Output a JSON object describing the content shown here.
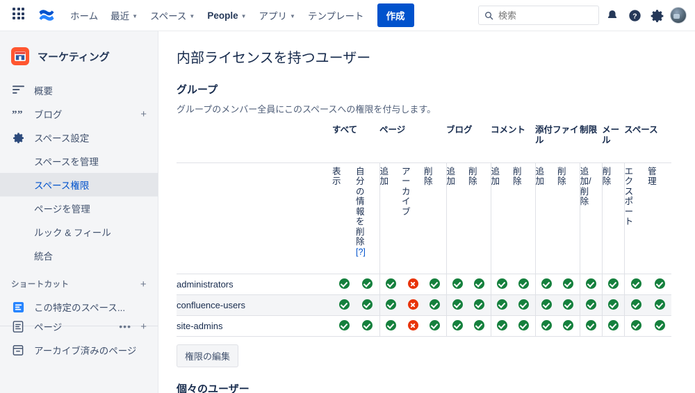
{
  "topnav": {
    "app_switcher": "app-switcher-icon",
    "logo": "confluence-logo",
    "items": [
      {
        "label": "ホーム",
        "caret": false,
        "bold": false
      },
      {
        "label": "最近",
        "caret": true,
        "bold": false
      },
      {
        "label": "スペース",
        "caret": true,
        "bold": false
      },
      {
        "label": "People",
        "caret": true,
        "bold": true
      },
      {
        "label": "アプリ",
        "caret": true,
        "bold": false
      },
      {
        "label": "テンプレート",
        "caret": false,
        "bold": false
      }
    ],
    "create_label": "作成",
    "search_placeholder": "検索",
    "icons": [
      "notification-bell-icon",
      "help-icon",
      "settings-gear-icon",
      "avatar"
    ],
    "accent": "#0052cc"
  },
  "sidebar": {
    "space_name": "マーケティング",
    "space_icon_color": "#ff5630",
    "nav": [
      {
        "label": "概要",
        "icon": "overview-icon",
        "plus": false
      },
      {
        "label": "ブログ",
        "icon": "blog-quote-icon",
        "plus": true
      },
      {
        "label": "スペース設定",
        "icon": "gear-icon",
        "plus": false
      }
    ],
    "settings_children": [
      {
        "label": "スペースを管理",
        "active": false
      },
      {
        "label": "スペース権限",
        "active": true
      },
      {
        "label": "ページを管理",
        "active": false
      },
      {
        "label": "ルック & フィール",
        "active": false
      },
      {
        "label": "統合",
        "active": false
      }
    ],
    "shortcuts_label": "ショートカット",
    "shortcuts": [
      {
        "label": "この特定のスペース...",
        "icon": "page-blue-icon"
      }
    ],
    "pages_label": "ページ",
    "pages_icon": "page-icon",
    "archived_label": "アーカイブ済みのページ",
    "archived_icon": "archive-box-icon"
  },
  "main": {
    "page_title": "内部ライセンスを持つユーザー",
    "group_section_title": "グループ",
    "group_section_desc": "グループのメンバー全員にこのスペースへの権限を付与します。",
    "edit_button": "権限の編集",
    "individual_section_title": "個々のユーザー",
    "table": {
      "groups": [
        {
          "label": "すべて",
          "span": 2
        },
        {
          "label": "ページ",
          "span": 3
        },
        {
          "label": "ブログ",
          "span": 2
        },
        {
          "label": "コメント",
          "span": 2
        },
        {
          "label": "添付ファイル",
          "span": 2
        },
        {
          "label": "制限",
          "span": 1
        },
        {
          "label": "メール",
          "span": 1
        },
        {
          "label": "スペース",
          "span": 2
        }
      ],
      "subheaders": [
        {
          "label": "表示",
          "help": false,
          "group_start": true
        },
        {
          "label": "自分の情報を削除",
          "help": true,
          "help_label": "[?]",
          "group_start": false
        },
        {
          "label": "追加",
          "help": false,
          "group_start": true
        },
        {
          "label": "アーカイブ",
          "help": false,
          "group_start": false
        },
        {
          "label": "削除",
          "help": false,
          "group_start": false
        },
        {
          "label": "追加",
          "help": false,
          "group_start": true
        },
        {
          "label": "削除",
          "help": false,
          "group_start": false
        },
        {
          "label": "追加",
          "help": false,
          "group_start": true
        },
        {
          "label": "削除",
          "help": false,
          "group_start": false
        },
        {
          "label": "追加",
          "help": false,
          "group_start": true
        },
        {
          "label": "削除",
          "help": false,
          "group_start": false
        },
        {
          "label": "追加/削除",
          "help": false,
          "group_start": true
        },
        {
          "label": "削除",
          "help": false,
          "group_start": true
        },
        {
          "label": "エクスポート",
          "help": false,
          "group_start": true
        },
        {
          "label": "管理",
          "help": false,
          "group_start": false
        }
      ],
      "rows": [
        {
          "name": "administrators",
          "values": [
            "ok",
            "ok",
            "ok",
            "no",
            "ok",
            "ok",
            "ok",
            "ok",
            "ok",
            "ok",
            "ok",
            "ok",
            "ok",
            "ok",
            "ok"
          ]
        },
        {
          "name": "confluence-users",
          "values": [
            "ok",
            "ok",
            "ok",
            "no",
            "ok",
            "ok",
            "ok",
            "ok",
            "ok",
            "ok",
            "ok",
            "ok",
            "ok",
            "ok",
            "ok"
          ]
        },
        {
          "name": "site-admins",
          "values": [
            "ok",
            "ok",
            "ok",
            "no",
            "ok",
            "ok",
            "ok",
            "ok",
            "ok",
            "ok",
            "ok",
            "ok",
            "ok",
            "ok",
            "ok"
          ]
        }
      ],
      "mark_colors": {
        "ok": "#15803d",
        "no": "#e8340a"
      }
    }
  }
}
